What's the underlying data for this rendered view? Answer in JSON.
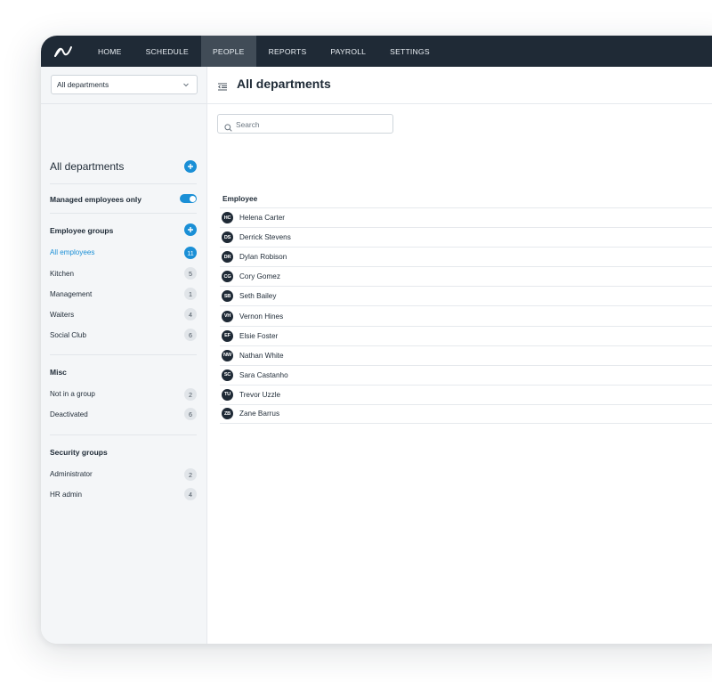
{
  "nav": {
    "items": [
      {
        "label": "HOME",
        "active": false
      },
      {
        "label": "SCHEDULE",
        "active": false
      },
      {
        "label": "PEOPLE",
        "active": true
      },
      {
        "label": "REPORTS",
        "active": false
      },
      {
        "label": "PAYROLL",
        "active": false
      },
      {
        "label": "SETTINGS",
        "active": false
      }
    ]
  },
  "sidebar": {
    "department_select": "All departments",
    "section_title": "All departments",
    "managed_toggle": {
      "label": "Managed employees only",
      "on": true
    },
    "employee_groups": {
      "title": "Employee groups",
      "items": [
        {
          "label": "All employees",
          "count": "11",
          "selected": true
        },
        {
          "label": "Kitchen",
          "count": "5"
        },
        {
          "label": "Management",
          "count": "1"
        },
        {
          "label": "Waiters",
          "count": "4"
        },
        {
          "label": "Social Club",
          "count": "6"
        }
      ]
    },
    "misc": {
      "title": "Misc",
      "items": [
        {
          "label": "Not in a group",
          "count": "2"
        },
        {
          "label": "Deactivated",
          "count": "6"
        }
      ]
    },
    "security_groups": {
      "title": "Security groups",
      "items": [
        {
          "label": "Administrator",
          "count": "2"
        },
        {
          "label": "HR admin",
          "count": "4"
        }
      ]
    }
  },
  "main": {
    "title": "All departments",
    "search_placeholder": "Search",
    "column_header": "Employee",
    "employees": [
      {
        "initials": "HC",
        "name": "Helena Carter"
      },
      {
        "initials": "DS",
        "name": "Derrick Stevens"
      },
      {
        "initials": "DR",
        "name": "Dylan Robison"
      },
      {
        "initials": "CG",
        "name": "Cory Gomez"
      },
      {
        "initials": "SB",
        "name": "Seth Bailey"
      },
      {
        "initials": "VH",
        "name": "Vernon Hines"
      },
      {
        "initials": "EF",
        "name": "Elsie Foster"
      },
      {
        "initials": "NW",
        "name": "Nathan White"
      },
      {
        "initials": "SC",
        "name": "Sara Castanho"
      },
      {
        "initials": "TU",
        "name": "Trevor Uzzle"
      },
      {
        "initials": "ZB",
        "name": "Zane Barrus"
      }
    ]
  },
  "colors": {
    "topbar": "#1f2a36",
    "active_tab": "#414c57",
    "accent": "#1a8fd6",
    "sidebar_bg": "#f4f6f8"
  },
  "icons": {
    "logo": "brand-logo-icon",
    "dropdown": "chevron-down-icon",
    "add": "plus-icon",
    "collapse": "collapse-sidebar-icon",
    "search": "search-icon"
  }
}
